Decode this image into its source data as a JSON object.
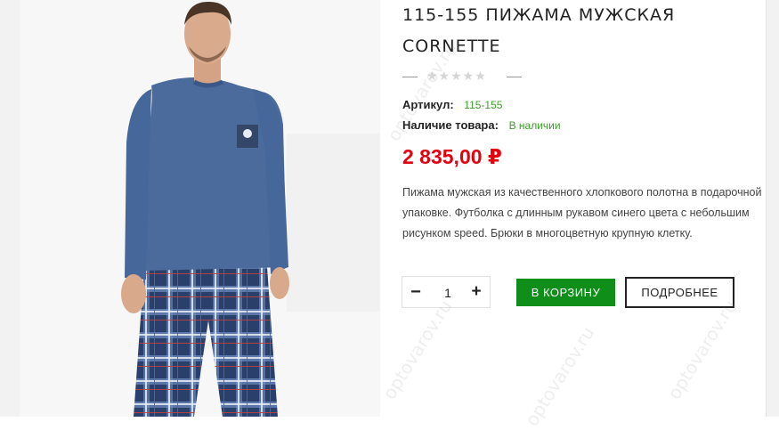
{
  "product": {
    "title": "115-155 ПИЖАМА МУЖСКАЯ CORNETTE",
    "rating_stars": "★★★★★",
    "sku_label": "Артикул:",
    "sku_value": "115-155",
    "availability_label": "Наличие товара:",
    "availability_value": "В наличии",
    "price": "2 835,00 ₽",
    "description": "Пижама мужская из качественного хлопкового полотна в подарочной упаковке. Футболка с длинным рукавом синего цвета с небольшим рисунком speed. Брюки в многоцветную крупную клетку."
  },
  "quantity": {
    "value": "1",
    "minus_symbol": "−",
    "plus_symbol": "+"
  },
  "buttons": {
    "add_to_cart": "В корзину",
    "details": "Подробнее"
  },
  "watermark_text": "optovarov.ru",
  "colors": {
    "price": "#e3000f",
    "availability": "#3e9e2c",
    "cart_button": "#0f8f1a",
    "shirt": "#4a6b9c"
  }
}
